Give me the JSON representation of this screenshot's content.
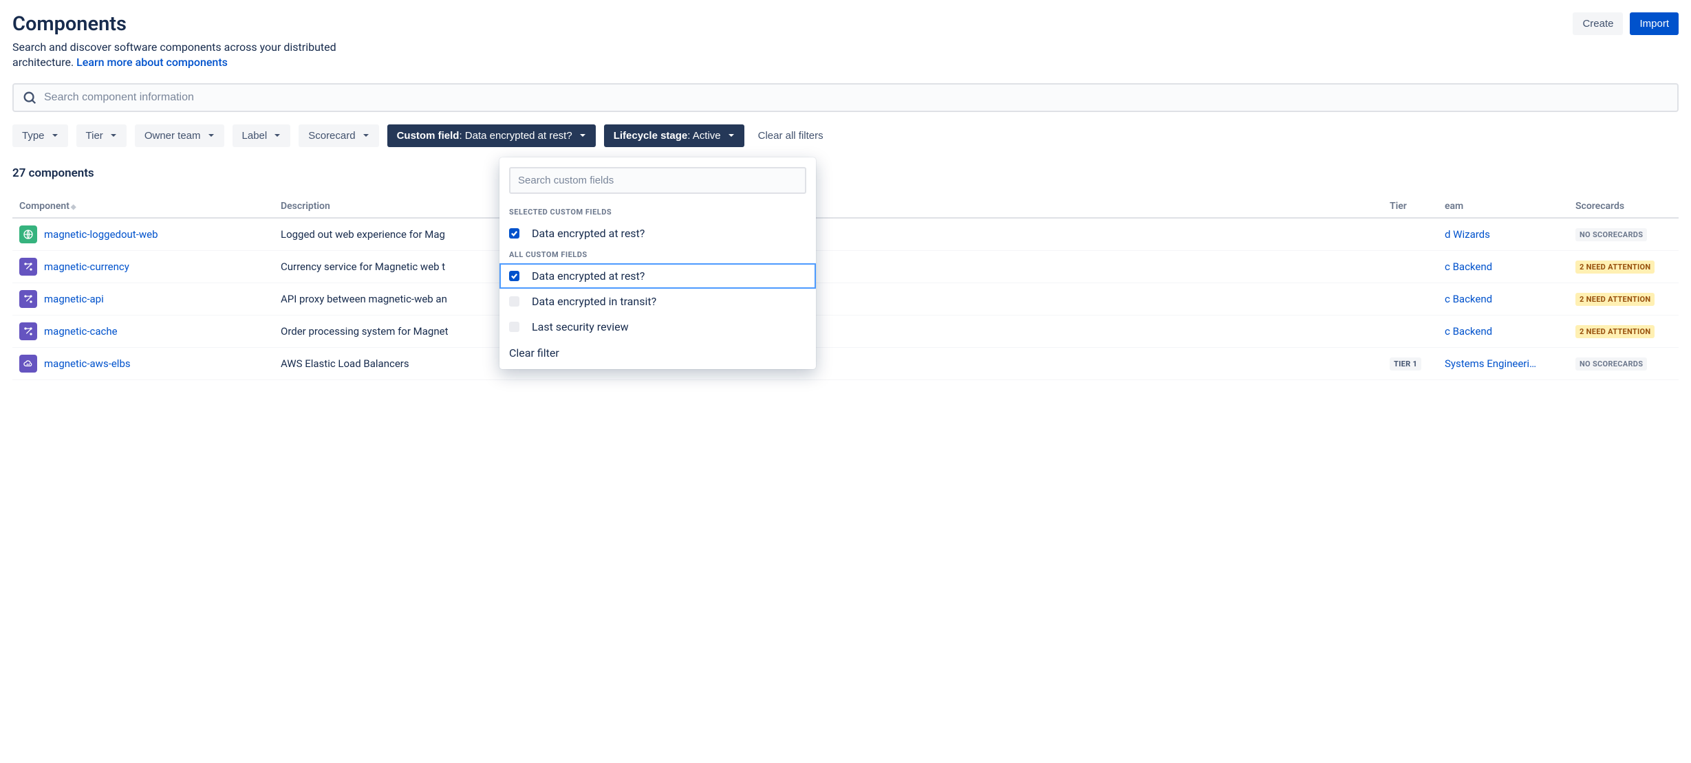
{
  "header": {
    "title": "Components",
    "create_label": "Create",
    "import_label": "Import",
    "subtitle_text": "Search and discover software components across your distributed architecture. ",
    "learn_more": "Learn more about components"
  },
  "search": {
    "placeholder": "Search component information"
  },
  "filters": {
    "type": "Type",
    "tier": "Tier",
    "owner_team": "Owner team",
    "label": "Label",
    "scorecard": "Scorecard",
    "custom_field_label": "Custom field",
    "custom_field_value": ": Data encrypted at rest?",
    "lifecycle_label": "Lifecycle stage",
    "lifecycle_value": ": Active",
    "clear_all": "Clear all filters"
  },
  "dropdown": {
    "search_placeholder": "Search custom fields",
    "selected_heading": "SELECTED CUSTOM FIELDS",
    "all_heading": "ALL CUSTOM FIELDS",
    "selected": [
      {
        "label": "Data encrypted at rest?",
        "checked": true
      }
    ],
    "all": [
      {
        "label": "Data encrypted at rest?",
        "checked": true,
        "highlighted": true
      },
      {
        "label": "Data encrypted in transit?",
        "checked": false
      },
      {
        "label": "Last security review",
        "checked": false
      }
    ],
    "clear_filter": "Clear filter"
  },
  "count_label": "27 components",
  "columns": {
    "component": "Component",
    "description": "Description",
    "tier": "Tier",
    "team": "Team",
    "scorecards": "Scorecards"
  },
  "scorecard_labels": {
    "none": "NO SCORECARDS",
    "attention": "2 NEED ATTENTION"
  },
  "rows": [
    {
      "name": "magnetic-loggedout-web",
      "icon": "globe",
      "color": "green",
      "description": "Logged out web experience for Mag",
      "tier": "",
      "team": "d Wizards",
      "scorecard": "none"
    },
    {
      "name": "magnetic-currency",
      "icon": "nodes",
      "color": "purple",
      "description": "Currency service for Magnetic web t",
      "tier": "",
      "team": "c Backend",
      "scorecard": "attention"
    },
    {
      "name": "magnetic-api",
      "icon": "nodes",
      "color": "purple",
      "description": "API proxy between magnetic-web an",
      "tier": "",
      "team": "c Backend",
      "scorecard": "attention"
    },
    {
      "name": "magnetic-cache",
      "icon": "nodes",
      "color": "purple",
      "description": "Order processing system for Magnet",
      "tier": "",
      "team": "c Backend",
      "scorecard": "attention"
    },
    {
      "name": "magnetic-aws-elbs",
      "icon": "cloud",
      "color": "purple",
      "description": "AWS Elastic Load Balancers",
      "tier": "TIER 1",
      "team": "Systems Engineeri…",
      "scorecard": "none"
    }
  ]
}
